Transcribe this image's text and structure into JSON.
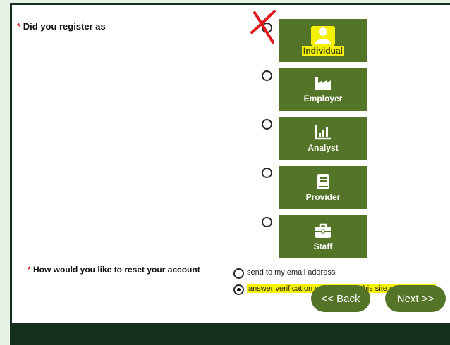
{
  "question_registration": {
    "required_mark": "*",
    "label": "Did you register as"
  },
  "user_types": [
    {
      "label": "Individual",
      "icon": "person-icon",
      "selected": true
    },
    {
      "label": "Employer",
      "icon": "factory-icon",
      "selected": false
    },
    {
      "label": "Analyst",
      "icon": "bar-chart-icon",
      "selected": false
    },
    {
      "label": "Provider",
      "icon": "book-icon",
      "selected": false
    },
    {
      "label": "Staff",
      "icon": "briefcase-icon",
      "selected": false
    }
  ],
  "question_reset": {
    "required_mark": "*",
    "label": "How would you like to reset your account",
    "options": [
      {
        "label": "send to my email address",
        "checked": false
      },
      {
        "label": "answer verification questions on this site and display it",
        "checked": true
      }
    ]
  },
  "buttons": {
    "back": "<< Back",
    "next": "Next >>"
  },
  "colors": {
    "tile_green": "#547528",
    "highlight_yellow": "#f5ef00",
    "required_red": "#d21f1f",
    "annotation_red": "#e0191c"
  }
}
